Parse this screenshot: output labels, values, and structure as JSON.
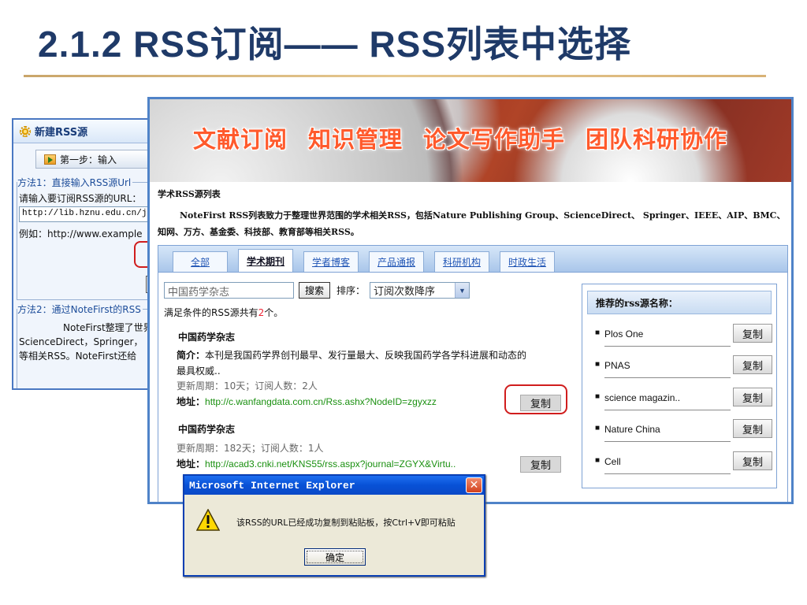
{
  "slide": {
    "title": "2.1.2  RSS订阅—— RSS列表中选择"
  },
  "bg_dialog": {
    "title": "新建RSS源",
    "step_label": "第一步：输入",
    "method1_legend": "方法1：直接输入RSS源Url",
    "method1_prompt": "请输入要订阅RSS源的URL：",
    "url_value": "http://lib.hznu.edu.cn/j",
    "example": "例如：http://www.example",
    "method2_legend": "方法2：通过NoteFirst的RSS",
    "method2_line1": "NoteFirst整理了世界",
    "method2_line2": "ScienceDirect，Springer，",
    "method2_line3": "等相关RSS。NoteFirst还给"
  },
  "banner": {
    "items": [
      "文献订阅",
      "知识管理",
      "论文写作助手",
      "团队科研协作"
    ]
  },
  "rss_list": {
    "heading": "学术RSS源列表",
    "intro": "NoteFirst RSS列表致力于整理世界范围的学术相关RSS，包括Nature Publishing Group、ScienceDirect、 Springer、IEEE、AIP、BMC、知网、万方、基金委、科技部、教育部等相关RSS。"
  },
  "tabs": [
    "全部",
    "学术期刊",
    "学者博客",
    "产品通报",
    "科研机构",
    "时政生活"
  ],
  "search": {
    "value": "中国药学杂志",
    "button": "搜索",
    "sort_label": "排序：",
    "sort_value": "订阅次数降序"
  },
  "count": {
    "prefix": "满足条件的RSS源共有",
    "num": "2",
    "suffix": "个。"
  },
  "results": [
    {
      "title": "中国药学杂志",
      "intro_label": "简介：",
      "intro_line1": "本刊是我国药学界创刊最早、发行量最大、反映我国药学各学科进展和动态的",
      "intro_line2": "最具权威..",
      "meta": "更新周期：10天；订阅人数：2人",
      "url_label": "地址：",
      "url": "http://c.wanfangdata.com.cn/Rss.ashx?NodeID=zgyxzz",
      "copy": "复制"
    },
    {
      "title": "中国药学杂志",
      "meta": "更新周期：182天；订阅人数：1人",
      "url_label": "地址：",
      "url": "http://acad3.cnki.net/KNS55/rss.aspx?journal=ZGYX&Virtu..",
      "copy": "复制"
    }
  ],
  "recommended": {
    "heading": "推荐的rss源名称：",
    "items": [
      {
        "name": "Plos One",
        "copy": "复制"
      },
      {
        "name": "PNAS",
        "copy": "复制"
      },
      {
        "name": "science magazin..",
        "copy": "复制"
      },
      {
        "name": "Nature China",
        "copy": "复制"
      },
      {
        "name": "Cell",
        "copy": "复制"
      }
    ]
  },
  "ie_dialog": {
    "title": "Microsoft Internet Explorer",
    "close": "✕",
    "message": "该RSS的URL已经成功复制到粘贴板，按Ctrl+V即可粘贴",
    "ok": "确定"
  },
  "colors": {
    "title": "#1f3a68",
    "highlight": "#d01d1d",
    "tab_link": "#2055b5",
    "url": "#1a9010"
  },
  "icons": [
    "gear-icon",
    "step-arrow-icon",
    "warning-icon",
    "dropdown-arrow-icon",
    "close-icon",
    "bullet-icon"
  ]
}
